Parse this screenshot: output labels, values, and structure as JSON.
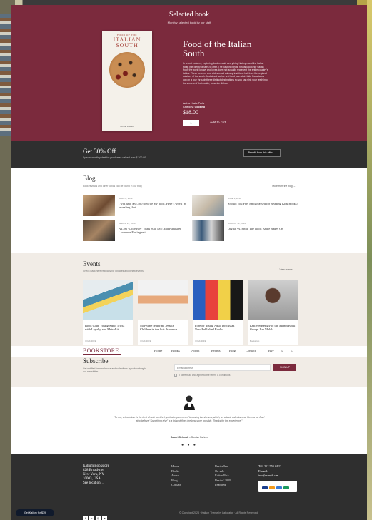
{
  "featured": {
    "heading": "Selected book",
    "subheading": "Monthly selected book by our staff",
    "cover_top": "FOOD OF THE",
    "cover_title": "ITALIAN SOUTH",
    "cover_author": "KATIE PARLA",
    "title": "Food of the Italian South",
    "description": "In recent cultures, exploring food reveals everything history—and the Italian south has plenty of tales to offer. The pastoral fields, forward-looking “Italian food” the world knows and loves does not actually represent the entire country's tables. These beloved and widespread culinary traditions hail from the regional cuisines of the south. Acclaimed author and food journalist Katie Parla takes you on a tour through these distinct destinations so you can sink your teeth into the secrets of their rustic, romantic dishes.",
    "author_label": "Author:",
    "author": "Katie Parla",
    "category_label": "Category:",
    "category": "Cooking",
    "price": "$18.00",
    "qty": "1",
    "add_to_cart": "Add to cart"
  },
  "promo": {
    "title": "Get 30% Off",
    "subtitle": "Special monthly deal for purchases valued over $ 200.00",
    "button": "Benefit from this offer →"
  },
  "blog": {
    "title": "Blog",
    "subtitle": "Book reviews and other topics can be found in our blog",
    "link": "More from the blog →",
    "posts": [
      {
        "date": "APRIL 8, 2019",
        "title": "I was paid $82,500 to write my book. Here’s why I’m revealing that"
      },
      {
        "date": "JUNE 1, 2019",
        "title": "Should You Feel Embarrassed for Reading Kids Books?"
      },
      {
        "date": "MARCH 23, 2019",
        "title": "A Lost ‘Little Boy’ Years 80th Doc And Publisher Lawrence Ferlinghetti"
      },
      {
        "date": "AUGUST 12, 2019",
        "title": "Digital vs. Print: The Book Battle Rages On"
      }
    ]
  },
  "events": {
    "title": "Events",
    "subtitle": "Check back here regularly for updates about new events.",
    "link": "View events →",
    "items": [
      {
        "title": "Book Club: Young Adult Trivia with Loyalty and MetroLit",
        "date": "7 Feb 2019"
      },
      {
        "title": "Storytime featuring Jessica Children in the Arts Prudence",
        "date": "7 Feb 2019"
      },
      {
        "title": "Forever Young Adult Discusses New Published Books",
        "date": "7 Feb 2019"
      },
      {
        "title": "Last Wednesday of the Month Book Group: I’m Malala",
        "date": "Bookshop"
      }
    ]
  },
  "header": {
    "logo": "BOOKSTORE",
    "nav": [
      "Home",
      "Books",
      "About",
      "Events",
      "Blog",
      "Contact",
      "Buy"
    ]
  },
  "subscribe": {
    "title": "Subscribe",
    "description": "Get notified for new books and collections by subscribing to our newsletter.",
    "email_placeholder": "Email address",
    "button": "SIGN UP",
    "agree": "I have read and agree to the terms & conditions"
  },
  "testimonial": {
    "quote": "“To me, a bookstore is the best of both worlds. I get that experience of browsing the shelves, which, as a book collector and, I love a lot. But I also believe “Something else” is a thing defines the best store possible. Thanks for the experience.”",
    "author": "Robert Schmidt",
    "role": "Sunrise Partner",
    "dots": "● ● ●"
  },
  "footer": {
    "address": [
      "Kalium Bookstore",
      "828 Broadway,",
      "New York, NY",
      "10003, USA",
      "See location →"
    ],
    "links1": [
      "Home",
      "Books",
      "About",
      "Blog",
      "Contact"
    ],
    "links2": [
      "Bestsellers",
      "On sale",
      "Editor Pick",
      "Best of 2019",
      "Featured"
    ],
    "tel": "Tel: 212 555 0122",
    "email_label": "E-mail:",
    "email": "info@example.com",
    "copyright": "© Copyright 2023 · Kalium Theme by Laborator · All Rights Reserved"
  },
  "floating": {
    "get_button": "Get Kalium for $39"
  },
  "colors": {
    "brand": "#7b2a3d",
    "dark": "#2f2f2f",
    "cream": "#f1ece6"
  }
}
